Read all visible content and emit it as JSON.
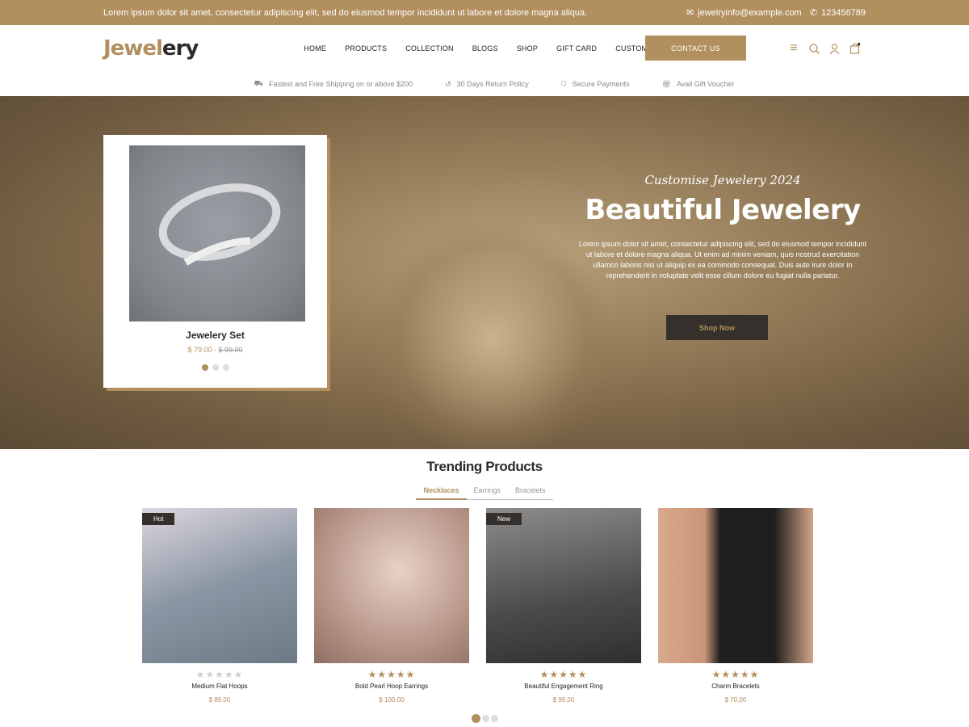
{
  "topbar": {
    "message": "Lorem ipsum dolor sit amet, consectetur adipiscing elit, sed do eiusmod tempor incididunt ut labore et dolore magna aliqua.",
    "email": "jewelryinfo@example.com",
    "phone": "123456789"
  },
  "header": {
    "logo_a": "Jewel",
    "logo_b": "ery",
    "nav": [
      "HOME",
      "PRODUCTS",
      "COLLECTION",
      "BLOGS",
      "SHOP",
      "GIFT CARD",
      "CUSTOMISE"
    ],
    "contact_label": "CONTACT US",
    "cart_count": "0"
  },
  "features": [
    "Fastest and Free Shipping on or above $200",
    "30 Days Return Policy",
    "Secure Payments",
    "Avail Gift Voucher"
  ],
  "hero": {
    "card": {
      "title": "Jewelery Set",
      "price": "$ 79.00",
      "old_price": "$ 99.00"
    },
    "subtitle": "Customise Jewelery 2024",
    "title": "Beautiful Jewelery",
    "body": "Lorem ipsum dolor sit amet, consectetur adipiscing elit, sed do eiusmod tempor incididunt ut labore et dolore magna aliqua. Ut enim ad minim veniam, quis nostrud exercitation ullamco laboris nisi ut aliquip ex ea commodo consequat. Duis aute irure dolor in reprehenderit in voluptate velit esse cillum dolore eu fugiat nulla pariatur.",
    "button": "Shop Now"
  },
  "trending": {
    "title": "Trending Products",
    "tabs": [
      "Necklaces",
      "Earrings",
      "Bracelets"
    ],
    "products": [
      {
        "name": "Medium Flat Hoops",
        "price": "$ 89.00",
        "badge": "Hot",
        "rating": 0
      },
      {
        "name": "Bold Pearl Hoop Earrings",
        "price": "$ 100.00",
        "badge": "",
        "rating": 5
      },
      {
        "name": "Beautiful Engagement Ring",
        "price": "$ 99.00",
        "badge": "New",
        "rating": 5
      },
      {
        "name": "Charm Bracelets",
        "price": "$ 70.00",
        "badge": "",
        "rating": 5
      }
    ]
  },
  "colors": {
    "accent": "#b28f5f",
    "dark": "#35302c"
  }
}
